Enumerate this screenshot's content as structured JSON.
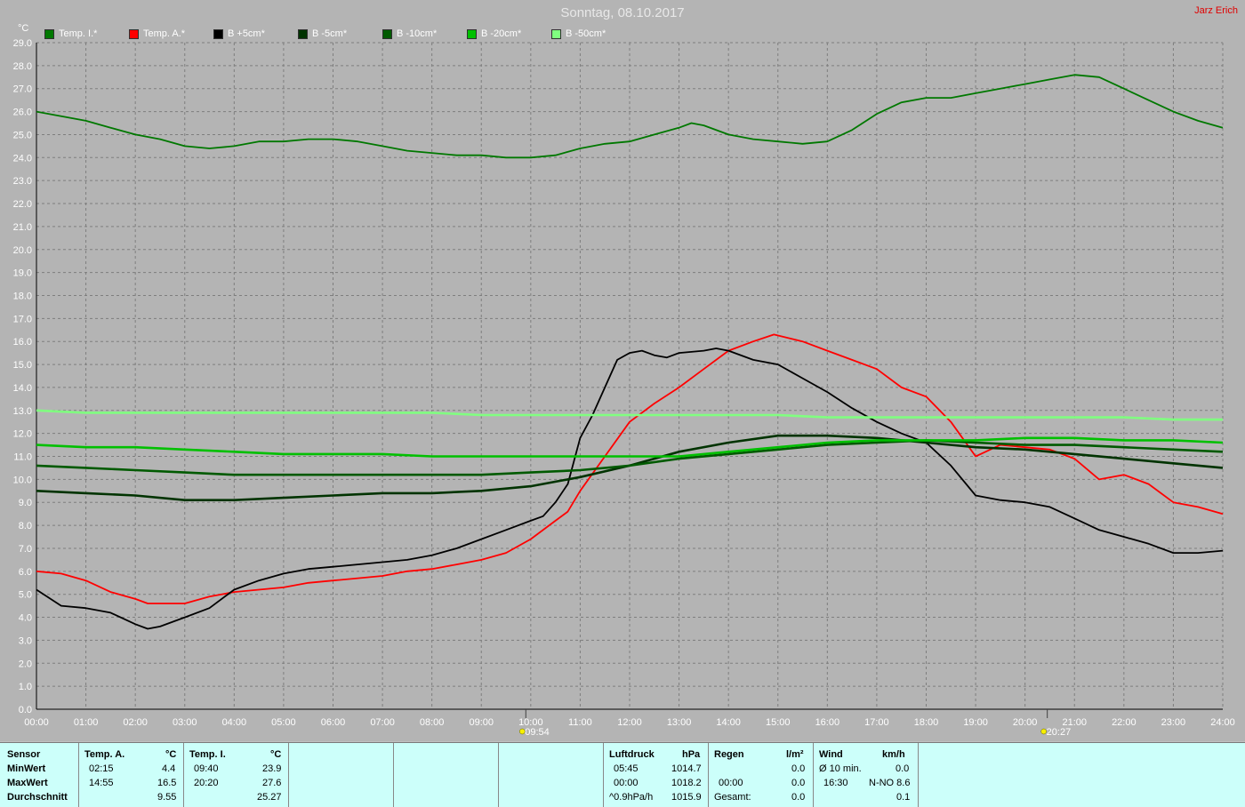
{
  "header": {
    "title": "Sonntag, 08.10.2017",
    "author": "Jarz Erich"
  },
  "chart_data": {
    "type": "line",
    "ylabel": "°C",
    "ylim": [
      0,
      29
    ],
    "xlim": [
      0,
      24
    ],
    "grid": true,
    "legend_position": "top-left",
    "x_tick_labels": [
      "00:00",
      "01:00",
      "02:00",
      "03:00",
      "04:00",
      "05:00",
      "06:00",
      "07:00",
      "08:00",
      "09:00",
      "10:00",
      "11:00",
      "12:00",
      "13:00",
      "14:00",
      "15:00",
      "16:00",
      "17:00",
      "18:00",
      "19:00",
      "20:00",
      "21:00",
      "22:00",
      "23:00",
      "24:00"
    ],
    "y_tick_labels": [
      "0.0",
      "1.0",
      "2.0",
      "3.0",
      "4.0",
      "5.0",
      "6.0",
      "7.0",
      "8.0",
      "9.0",
      "10.0",
      "11.0",
      "12.0",
      "13.0",
      "14.0",
      "15.0",
      "16.0",
      "17.0",
      "18.0",
      "19.0",
      "20.0",
      "21.0",
      "22.0",
      "23.0",
      "24.0",
      "25.0",
      "26.0",
      "27.0",
      "28.0",
      "29.0"
    ],
    "annotations": [
      {
        "x": 9.9,
        "label": "09:54",
        "type": "sunrise"
      },
      {
        "x": 20.45,
        "label": "20:27",
        "type": "sunset"
      }
    ],
    "series": [
      {
        "name": "Temp. I.*",
        "color": "#007800",
        "x": [
          0,
          0.5,
          1,
          1.5,
          2,
          2.5,
          3,
          3.5,
          4,
          4.5,
          5,
          5.5,
          6,
          6.5,
          7,
          7.5,
          8,
          8.5,
          9,
          9.5,
          10,
          10.5,
          11,
          11.5,
          12,
          12.5,
          13,
          13.25,
          13.5,
          14,
          14.5,
          15,
          15.5,
          16,
          16.5,
          17,
          17.5,
          18,
          18.5,
          19,
          19.5,
          20,
          20.5,
          21,
          21.5,
          22,
          22.5,
          23,
          23.5,
          24
        ],
        "y": [
          26.0,
          25.8,
          25.6,
          25.3,
          25.0,
          24.8,
          24.5,
          24.4,
          24.5,
          24.7,
          24.7,
          24.8,
          24.8,
          24.7,
          24.5,
          24.3,
          24.2,
          24.1,
          24.1,
          24.0,
          24.0,
          24.1,
          24.4,
          24.6,
          24.7,
          25.0,
          25.3,
          25.5,
          25.4,
          25.0,
          24.8,
          24.7,
          24.6,
          24.7,
          25.2,
          25.9,
          26.4,
          26.6,
          26.6,
          26.8,
          27.0,
          27.2,
          27.4,
          27.6,
          27.5,
          27.0,
          26.5,
          26.0,
          25.6,
          25.3
        ]
      },
      {
        "name": "Temp. A.*",
        "color": "#ff0000",
        "x": [
          0,
          0.5,
          1,
          1.5,
          2,
          2.25,
          2.5,
          3,
          3.5,
          4,
          4.5,
          5,
          5.5,
          6,
          6.5,
          7,
          7.5,
          8,
          8.5,
          9,
          9.5,
          10,
          10.5,
          10.75,
          11,
          11.5,
          12,
          12.5,
          13,
          13.5,
          14,
          14.5,
          14.92,
          15.5,
          16,
          16.5,
          17,
          17.5,
          18,
          18.5,
          19,
          19.5,
          20,
          20.5,
          21,
          21.5,
          22,
          22.5,
          23,
          23.5,
          24
        ],
        "y": [
          6.0,
          5.9,
          5.6,
          5.1,
          4.8,
          4.6,
          4.6,
          4.6,
          4.9,
          5.1,
          5.2,
          5.3,
          5.5,
          5.6,
          5.7,
          5.8,
          6.0,
          6.1,
          6.3,
          6.5,
          6.8,
          7.4,
          8.2,
          8.6,
          9.5,
          11.0,
          12.5,
          13.3,
          14.0,
          14.8,
          15.6,
          16.0,
          16.3,
          16.0,
          15.6,
          15.2,
          14.8,
          14.0,
          13.6,
          12.5,
          11.0,
          11.5,
          11.4,
          11.3,
          10.9,
          10.0,
          10.2,
          9.8,
          9.0,
          8.8,
          8.5
        ]
      },
      {
        "name": "B +5cm*",
        "color": "#000000",
        "x": [
          0,
          0.5,
          1,
          1.5,
          2,
          2.25,
          2.5,
          3,
          3.5,
          4,
          4.5,
          5,
          5.5,
          6,
          6.5,
          7,
          7.5,
          8,
          8.5,
          9,
          9.5,
          10,
          10.25,
          10.5,
          10.75,
          11,
          11.25,
          11.5,
          11.75,
          12,
          12.25,
          12.5,
          12.75,
          13,
          13.5,
          13.75,
          14,
          14.5,
          15,
          15.5,
          16,
          16.5,
          17,
          17.5,
          18,
          18.5,
          19,
          19.5,
          20,
          20.5,
          21,
          21.5,
          22,
          22.5,
          23,
          23.5,
          24
        ],
        "y": [
          5.2,
          4.5,
          4.4,
          4.2,
          3.7,
          3.5,
          3.6,
          4.0,
          4.4,
          5.2,
          5.6,
          5.9,
          6.1,
          6.2,
          6.3,
          6.4,
          6.5,
          6.7,
          7.0,
          7.4,
          7.8,
          8.2,
          8.4,
          9.0,
          9.8,
          11.8,
          12.8,
          14.0,
          15.2,
          15.5,
          15.6,
          15.4,
          15.3,
          15.5,
          15.6,
          15.7,
          15.6,
          15.2,
          15.0,
          14.4,
          13.8,
          13.1,
          12.5,
          12.0,
          11.6,
          10.6,
          9.3,
          9.1,
          9.0,
          8.8,
          8.3,
          7.8,
          7.5,
          7.2,
          6.8,
          6.8,
          6.9
        ]
      },
      {
        "name": "B -5cm*",
        "color": "#003300",
        "x": [
          0,
          1,
          2,
          3,
          4,
          5,
          6,
          7,
          8,
          9,
          10,
          11,
          12,
          13,
          14,
          15,
          16,
          17,
          18,
          19,
          20,
          21,
          22,
          23,
          24
        ],
        "y": [
          9.5,
          9.4,
          9.3,
          9.1,
          9.1,
          9.2,
          9.3,
          9.4,
          9.4,
          9.5,
          9.7,
          10.1,
          10.6,
          11.2,
          11.6,
          11.9,
          11.9,
          11.8,
          11.6,
          11.4,
          11.3,
          11.1,
          10.9,
          10.7,
          10.5
        ]
      },
      {
        "name": "B -10cm*",
        "color": "#005a00",
        "x": [
          0,
          1,
          2,
          3,
          4,
          5,
          6,
          7,
          8,
          9,
          10,
          11,
          12,
          13,
          14,
          15,
          16,
          17,
          18,
          19,
          20,
          21,
          22,
          23,
          24
        ],
        "y": [
          10.6,
          10.5,
          10.4,
          10.3,
          10.2,
          10.2,
          10.2,
          10.2,
          10.2,
          10.2,
          10.3,
          10.4,
          10.6,
          10.9,
          11.1,
          11.3,
          11.5,
          11.6,
          11.7,
          11.6,
          11.5,
          11.5,
          11.4,
          11.3,
          11.2
        ]
      },
      {
        "name": "B -20cm*",
        "color": "#00c000",
        "x": [
          0,
          1,
          2,
          3,
          4,
          5,
          6,
          7,
          8,
          9,
          10,
          11,
          12,
          13,
          14,
          15,
          16,
          17,
          18,
          19,
          20,
          21,
          22,
          23,
          24
        ],
        "y": [
          11.5,
          11.4,
          11.4,
          11.3,
          11.2,
          11.1,
          11.1,
          11.1,
          11.0,
          11.0,
          11.0,
          11.0,
          11.0,
          11.0,
          11.2,
          11.4,
          11.6,
          11.7,
          11.7,
          11.7,
          11.8,
          11.8,
          11.7,
          11.7,
          11.6
        ]
      },
      {
        "name": "B -50cm*",
        "color": "#80ff80",
        "x": [
          0,
          1,
          2,
          3,
          4,
          5,
          6,
          7,
          8,
          9,
          10,
          11,
          12,
          13,
          14,
          15,
          16,
          17,
          18,
          19,
          20,
          21,
          22,
          23,
          24
        ],
        "y": [
          13.0,
          12.9,
          12.9,
          12.9,
          12.9,
          12.9,
          12.9,
          12.9,
          12.9,
          12.8,
          12.8,
          12.8,
          12.8,
          12.8,
          12.8,
          12.8,
          12.7,
          12.7,
          12.7,
          12.7,
          12.7,
          12.7,
          12.7,
          12.6,
          12.6
        ]
      }
    ]
  },
  "stats": {
    "row_labels": [
      "Sensor",
      "MinWert",
      "MaxWert",
      "Durchschnitt"
    ],
    "temp_a": {
      "header": "Temp. A.",
      "unit": "°C",
      "min_time": "02:15",
      "min_value": "4.4",
      "max_time": "14:55",
      "max_value": "16.5",
      "avg": "9.55"
    },
    "temp_i": {
      "header": "Temp. I.",
      "unit": "°C",
      "min_time": "09:40",
      "min_value": "23.9",
      "max_time": "20:20",
      "max_value": "27.6",
      "avg": "25.27"
    },
    "pressure": {
      "header": "Luftdruck",
      "unit": "hPa",
      "min_time": "05:45",
      "min_value": "1014.7",
      "max_time": "00:00",
      "max_value": "1018.2",
      "trend": "^0.9hPa/h",
      "current": "1015.9"
    },
    "rain": {
      "header": "Regen",
      "unit": "l/m²",
      "time": "00:00",
      "value": "0.0",
      "total_label": "Gesamt:",
      "total": "0.0",
      "first": "0.0"
    },
    "wind": {
      "header": "Wind",
      "unit": "km/h",
      "avg_label": "Ø 10 min.",
      "avg": "0.0",
      "max_time": "16:30",
      "max_value": "N-NO 8.6",
      "day_avg": "0.1"
    }
  }
}
